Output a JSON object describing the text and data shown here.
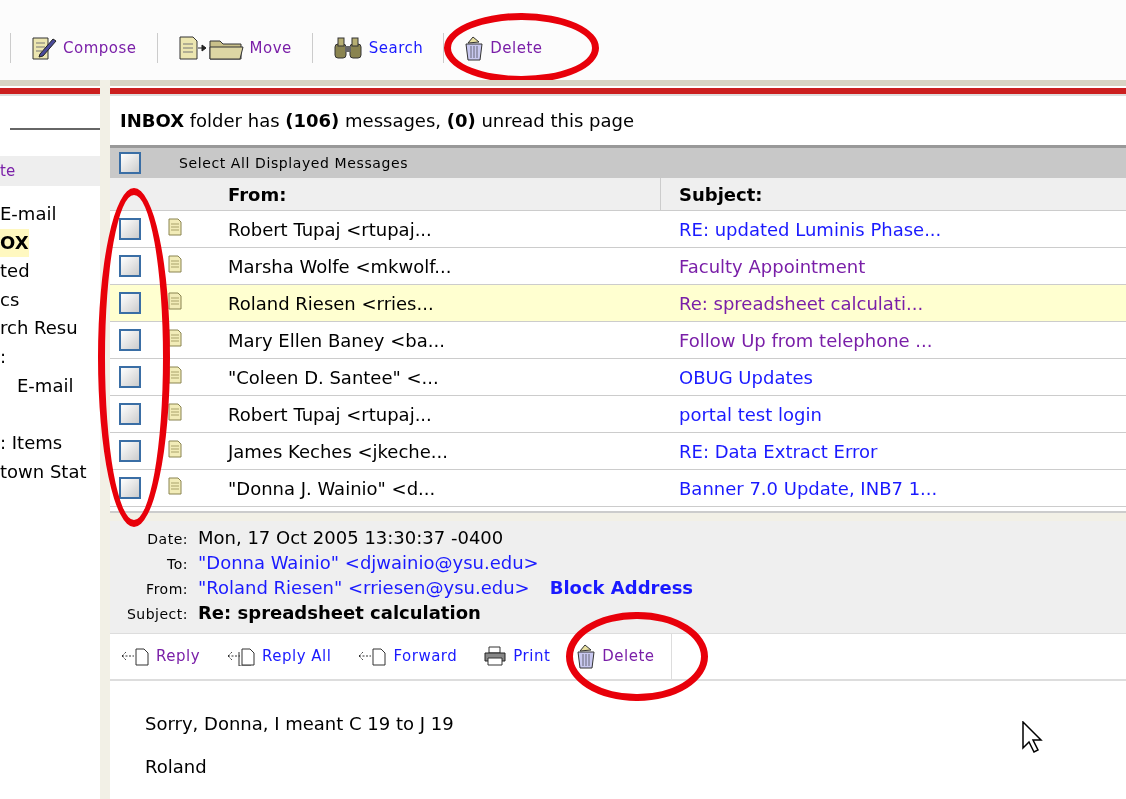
{
  "toolbar": [
    {
      "kind": "compose",
      "label": "Compose",
      "visited": true,
      "circled": false
    },
    {
      "kind": "move",
      "label": "Move",
      "visited": true,
      "circled": false
    },
    {
      "kind": "search",
      "label": "Search",
      "visited": false,
      "circled": false
    },
    {
      "kind": "delete",
      "label": "Delete",
      "visited": true,
      "circled": true
    }
  ],
  "sidebar": {
    "link": "te",
    "groups": [
      [
        {
          "label": "E-mail",
          "selected": false
        },
        {
          "label": "OX",
          "selected": true
        },
        {
          "label": "ted",
          "selected": false
        },
        {
          "label": "cs",
          "selected": false
        },
        {
          "label": "rch Resu",
          "selected": false
        },
        {
          "label": ":",
          "selected": false,
          "children": [
            {
              "label": "E-mail",
              "selected": false
            }
          ]
        }
      ],
      [
        {
          "label": ": Items",
          "selected": false
        },
        {
          "label": "town Stat",
          "selected": false
        }
      ]
    ]
  },
  "summary": "**INBOX** folder has **(106)** messages, **(0)** unread this page",
  "select_all": {
    "label": "Select All Displayed Messages",
    "checked": false
  },
  "checkboxes_circled": true,
  "columns": [
    "From:",
    "Subject:"
  ],
  "messages": [
    {
      "from": "Robert Tupaj <rtupaj...",
      "subject": "RE: updated Luminis Phase...",
      "visited": false,
      "selected": false,
      "checked": false
    },
    {
      "from": "Marsha Wolfe <mkwolf...",
      "subject": "Faculty Appointment",
      "visited": true,
      "selected": false,
      "checked": false
    },
    {
      "from": "Roland Riesen <rries...",
      "subject": "Re: spreadsheet calculati...",
      "visited": true,
      "selected": true,
      "checked": false
    },
    {
      "from": "Mary Ellen Baney <ba...",
      "subject": "Follow Up from telephone ...",
      "visited": true,
      "selected": false,
      "checked": false
    },
    {
      "from": "\"Coleen D. Santee\" <...",
      "subject": "OBUG Updates",
      "visited": false,
      "selected": false,
      "checked": false
    },
    {
      "from": "Robert Tupaj <rtupaj...",
      "subject": "portal test login",
      "visited": false,
      "selected": false,
      "checked": false
    },
    {
      "from": "James Keches <jkeche...",
      "subject": "RE: Data Extract Error",
      "visited": false,
      "selected": false,
      "checked": false
    },
    {
      "from": "\"Donna J. Wainio\" <d...",
      "subject": "Banner 7.0 Update, INB7 1...",
      "visited": false,
      "selected": false,
      "checked": false
    }
  ],
  "preview": {
    "headers": [
      {
        "label": "Date:",
        "value": "Mon, 17 Oct 2005 13:30:37 -0400",
        "kind": "text"
      },
      {
        "label": "To:",
        "value": "\"Donna Wainio\" <djwainio@ysu.edu>",
        "kind": "link"
      },
      {
        "label": "From:",
        "value": "\"Roland Riesen\" <rriesen@ysu.edu>",
        "kind": "link",
        "action": "Block Address"
      },
      {
        "label": "Subject:",
        "value": "Re: spreadsheet calculation",
        "kind": "bold"
      }
    ],
    "actions": [
      {
        "kind": "reply",
        "label": "Reply",
        "visited": true,
        "circled": false
      },
      {
        "kind": "reply_all",
        "label": "Reply All",
        "visited": false,
        "circled": false
      },
      {
        "kind": "forward",
        "label": "Forward",
        "visited": false,
        "circled": false
      },
      {
        "kind": "print",
        "label": "Print",
        "visited": false,
        "circled": false
      },
      {
        "kind": "delete",
        "label": "Delete",
        "visited": true,
        "circled": true
      }
    ],
    "body": [
      "Sorry, Donna, I meant C 19 to J 19",
      "Roland"
    ]
  }
}
